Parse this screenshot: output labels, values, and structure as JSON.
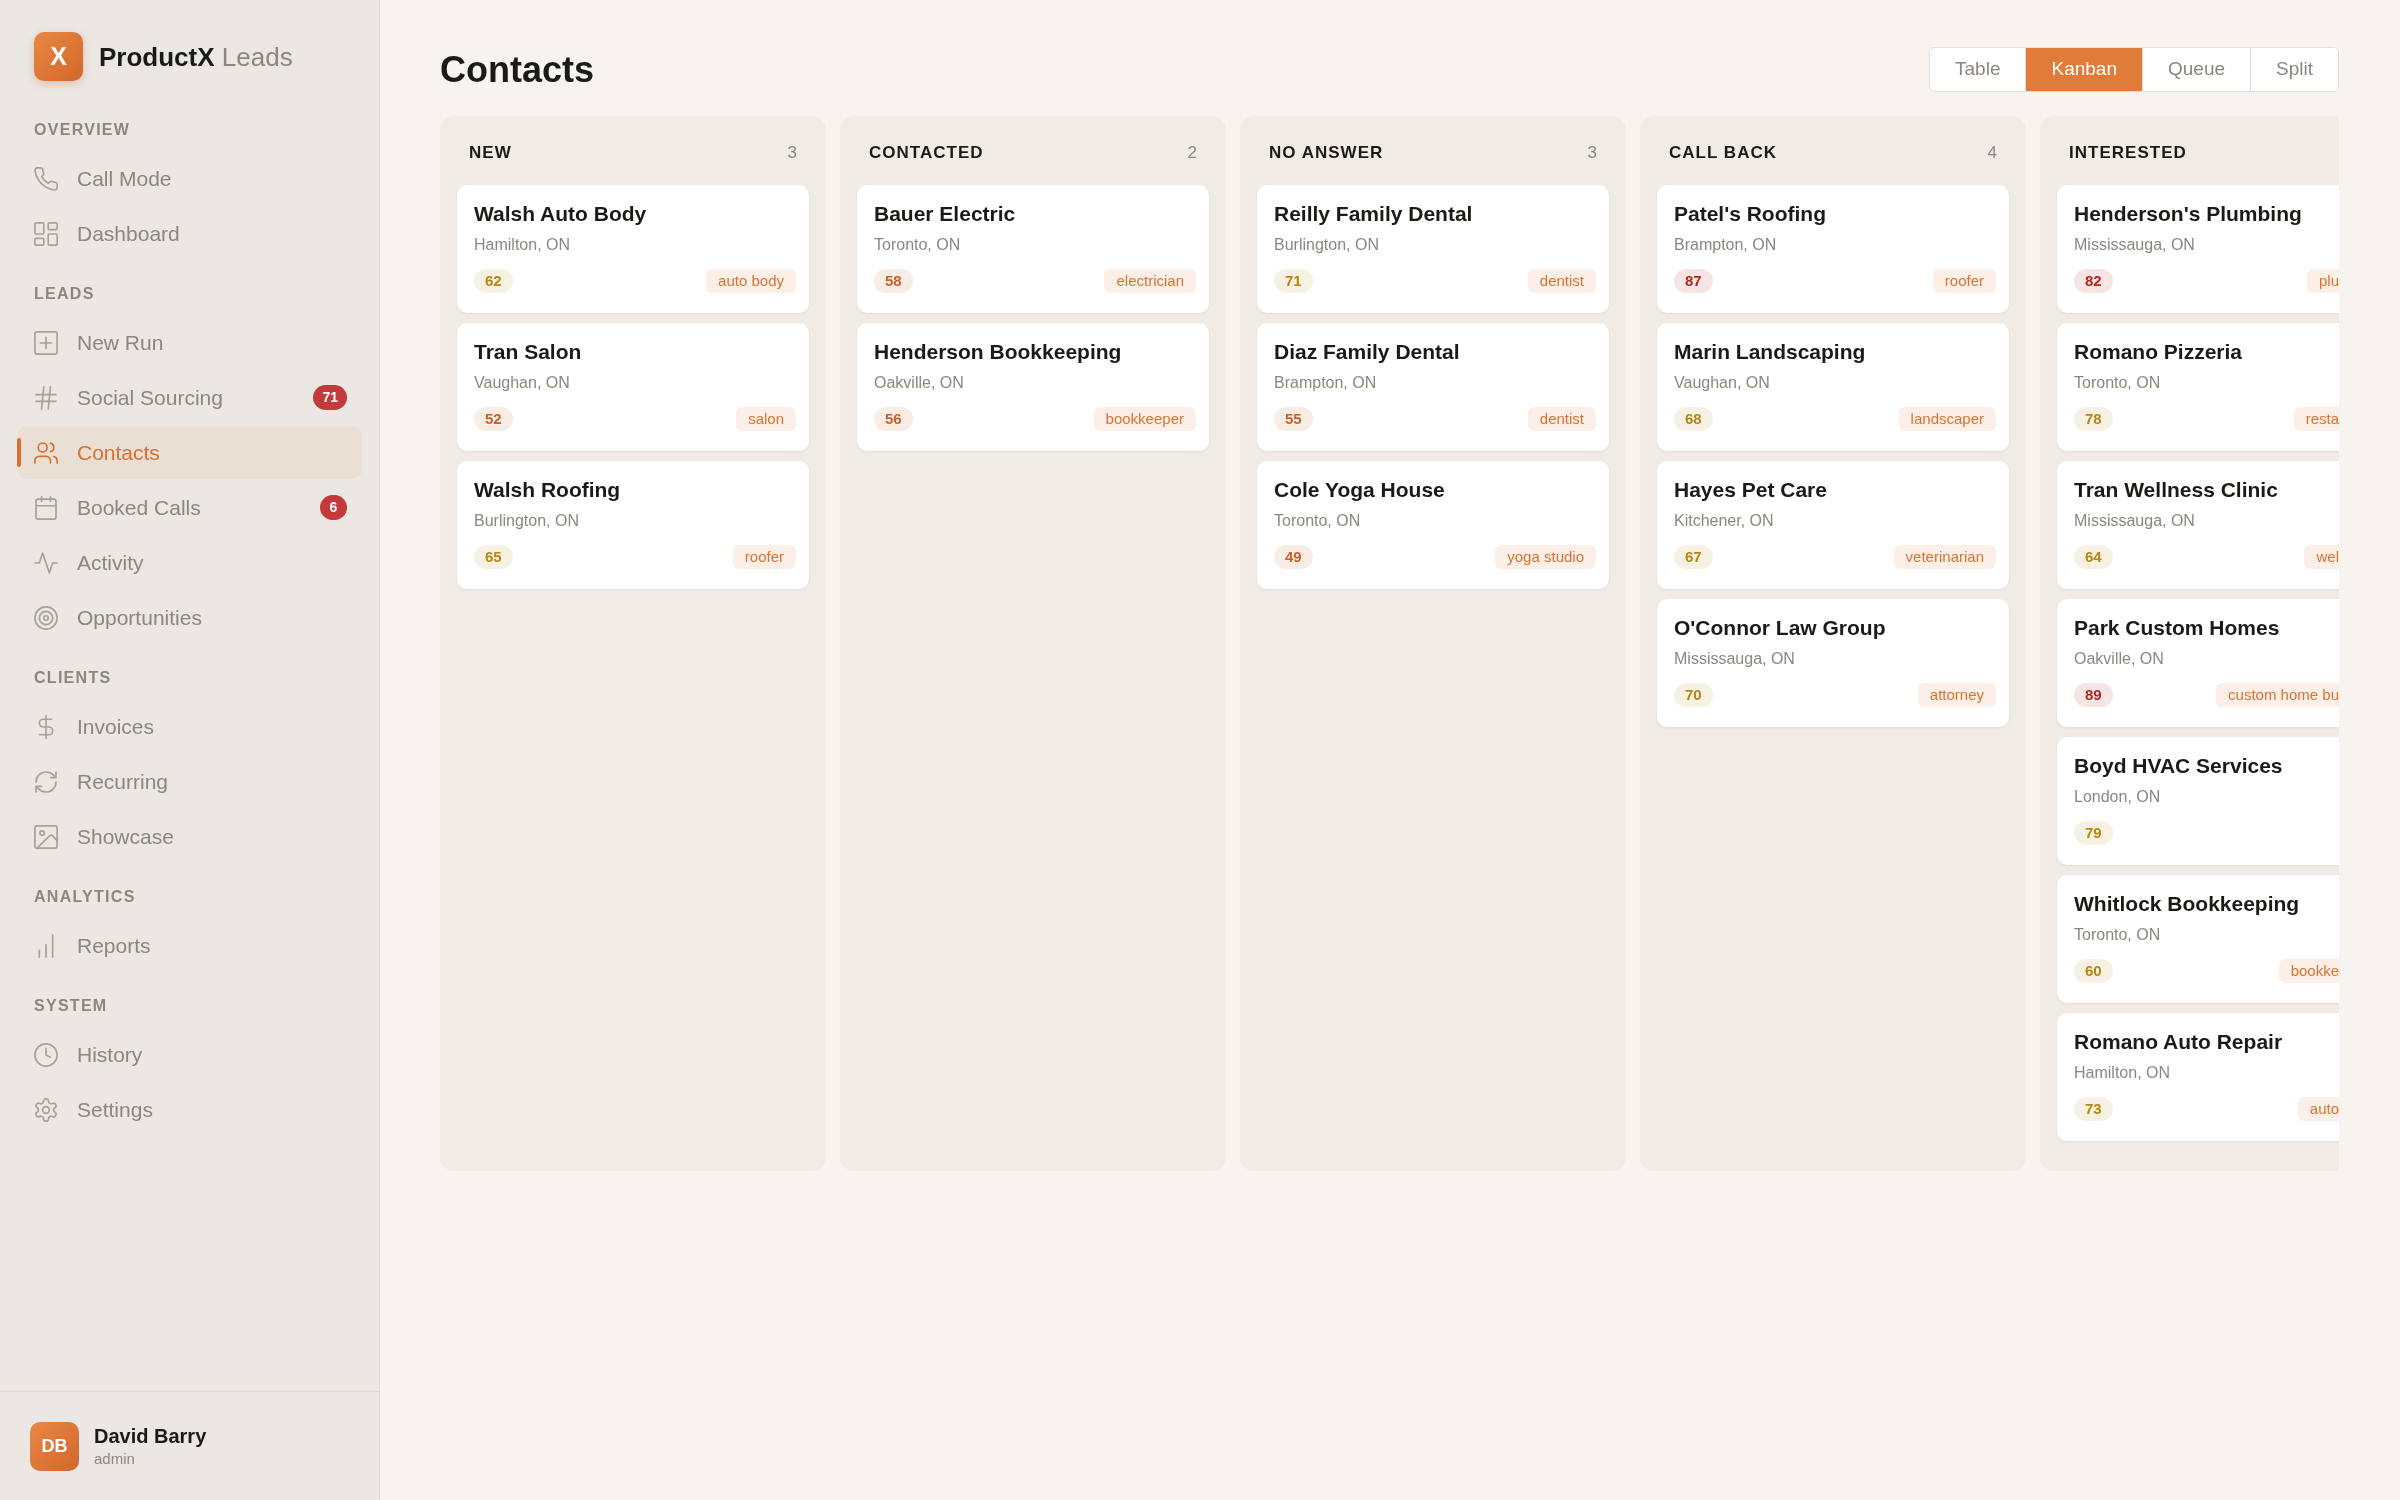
{
  "sidebar": {
    "brand": {
      "logo": "X",
      "name": "ProductX",
      "suffix": "Leads"
    },
    "sections": [
      {
        "label": "OVERVIEW",
        "items": [
          {
            "label": "Call Mode",
            "selected": false
          },
          {
            "label": "Dashboard",
            "selected": false
          }
        ]
      },
      {
        "label": "LEADS",
        "items": [
          {
            "label": "New Run",
            "selected": false
          },
          {
            "label": "Social Sourcing",
            "selected": false,
            "badge": "71"
          },
          {
            "label": "Contacts",
            "selected": true
          },
          {
            "label": "Booked Calls",
            "selected": false,
            "badge": "6"
          },
          {
            "label": "Activity",
            "selected": false
          },
          {
            "label": "Opportunities",
            "selected": false
          }
        ]
      },
      {
        "label": "CLIENTS",
        "items": [
          {
            "label": "Invoices",
            "selected": false
          },
          {
            "label": "Recurring",
            "selected": false
          },
          {
            "label": "Showcase",
            "selected": false
          }
        ]
      },
      {
        "label": "ANALYTICS",
        "items": [
          {
            "label": "Reports",
            "selected": false
          }
        ]
      },
      {
        "label": "SYSTEM",
        "items": [
          {
            "label": "History",
            "selected": false
          },
          {
            "label": "Settings",
            "selected": false
          }
        ]
      }
    ],
    "user": {
      "initials": "DB",
      "name": "David Barry",
      "role": "admin"
    }
  },
  "page": {
    "title": "Contacts"
  },
  "view_tabs": [
    {
      "label": "Table",
      "selected": false
    },
    {
      "label": "Kanban",
      "selected": true
    },
    {
      "label": "Queue",
      "selected": false
    },
    {
      "label": "Split",
      "selected": false
    }
  ],
  "board": {
    "columns": [
      {
        "title": "NEW",
        "count": "3",
        "clipped": false,
        "cards": [
          {
            "name": "Walsh Auto Body",
            "location": "Hamilton, ON",
            "score": "62",
            "color": "#b5870f",
            "tag": "auto body"
          },
          {
            "name": "Tran Salon",
            "location": "Vaughan, ON",
            "score": "52",
            "color": "#c8602a",
            "tag": "salon"
          },
          {
            "name": "Walsh Roofing",
            "location": "Burlington, ON",
            "score": "65",
            "color": "#b5870f",
            "tag": "roofer"
          }
        ]
      },
      {
        "title": "CONTACTED",
        "count": "2",
        "clipped": false,
        "cards": [
          {
            "name": "Bauer Electric",
            "location": "Toronto, ON",
            "score": "58",
            "color": "#c8602a",
            "tag": "electrician"
          },
          {
            "name": "Henderson Bookkeeping",
            "location": "Oakville, ON",
            "score": "56",
            "color": "#c8602a",
            "tag": "bookkeeper"
          }
        ]
      },
      {
        "title": "NO ANSWER",
        "count": "3",
        "clipped": false,
        "cards": [
          {
            "name": "Reilly Family Dental",
            "location": "Burlington, ON",
            "score": "71",
            "color": "#b5870f",
            "tag": "dentist"
          },
          {
            "name": "Diaz Family Dental",
            "location": "Brampton, ON",
            "score": "55",
            "color": "#c8602a",
            "tag": "dentist"
          },
          {
            "name": "Cole Yoga House",
            "location": "Toronto, ON",
            "score": "49",
            "color": "#c8602a",
            "tag": "yoga studio"
          }
        ]
      },
      {
        "title": "CALL BACK",
        "count": "4",
        "clipped": false,
        "cards": [
          {
            "name": "Patel's Roofing",
            "location": "Brampton, ON",
            "score": "87",
            "color": "#b3261e",
            "tag": "roofer"
          },
          {
            "name": "Marin Landscaping",
            "location": "Vaughan, ON",
            "score": "68",
            "color": "#b5870f",
            "tag": "landscaper"
          },
          {
            "name": "Hayes Pet Care",
            "location": "Kitchener, ON",
            "score": "67",
            "color": "#b5870f",
            "tag": "veterinarian"
          },
          {
            "name": "O'Connor Law Group",
            "location": "Mississauga, ON",
            "score": "70",
            "color": "#b5870f",
            "tag": "attorney"
          }
        ]
      },
      {
        "title": "INTERESTED",
        "clipped": true,
        "cards": [
          {
            "name": "Henderson's Plumbing",
            "location": "Mississauga, ON",
            "score": "82",
            "color": "#b3261e",
            "tag": "plu"
          },
          {
            "name": "Romano Pizzeria",
            "location": "Toronto, ON",
            "score": "78",
            "color": "#b5870f",
            "tag": "resta"
          },
          {
            "name": "Tran Wellness Clinic",
            "location": "Mississauga, ON",
            "score": "64",
            "color": "#b5870f",
            "tag": "wel"
          },
          {
            "name": "Park Custom Homes",
            "location": "Oakville, ON",
            "score": "89",
            "color": "#b3261e",
            "tag": "custom home bu"
          },
          {
            "name": "Boyd HVAC Services",
            "location": "London, ON",
            "score": "79",
            "color": "#b5870f"
          },
          {
            "name": "Whitlock Bookkeeping",
            "location": "Toronto, ON",
            "score": "60",
            "color": "#b5870f",
            "tag": "bookke"
          },
          {
            "name": "Romano Auto Repair",
            "location": "Hamilton, ON",
            "score": "73",
            "color": "#b5870f",
            "tag": "auto"
          }
        ]
      }
    ]
  }
}
